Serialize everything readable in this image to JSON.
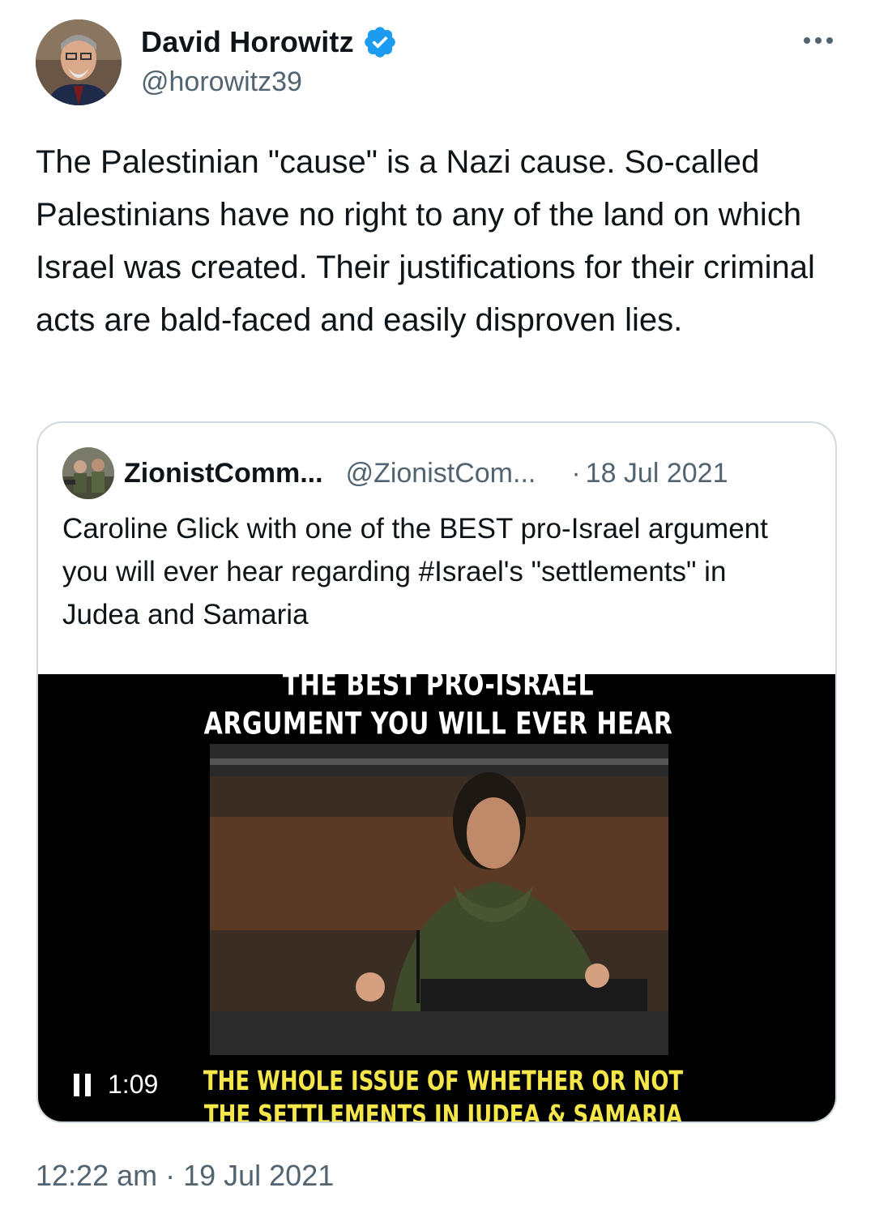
{
  "author": {
    "display_name": "David Horowitz",
    "handle": "@horowitz39",
    "verified": true
  },
  "more_icon": "more-horizontal-icon",
  "tweet": {
    "text": "The Palestinian \"cause\" is a Nazi cause. So-called Palestinians have no right to any of the land on which Israel was created. Their justifications for their criminal acts are bald-faced and easily disproven lies.",
    "timestamp": "12:22 am · 19 Jul 2021"
  },
  "quoted_tweet": {
    "display_name": "ZionistComm...",
    "handle": "@ZionistCom...",
    "separator": "·",
    "date": "18 Jul 2021",
    "text": "Caroline Glick with one of the BEST pro-Israel argument you will ever hear regarding #Israel's \"settlements\" in Judea and Samaria",
    "video": {
      "title_line1": "THE BEST PRO-ISRAEL",
      "title_line2": "ARGUMENT YOU WILL EVER HEAR",
      "caption_line1": "THE WHOLE ISSUE OF WHETHER OR NOT",
      "caption_line2": "THE SETTLEMENTS IN JUDEA & SAMARIA",
      "time": "1:09",
      "state": "playing"
    }
  },
  "colors": {
    "text_primary": "#0f1419",
    "text_secondary": "#536471",
    "verified_blue": "#1d9bf0",
    "border": "#cfd9de",
    "caption_yellow": "#f5e64a"
  }
}
